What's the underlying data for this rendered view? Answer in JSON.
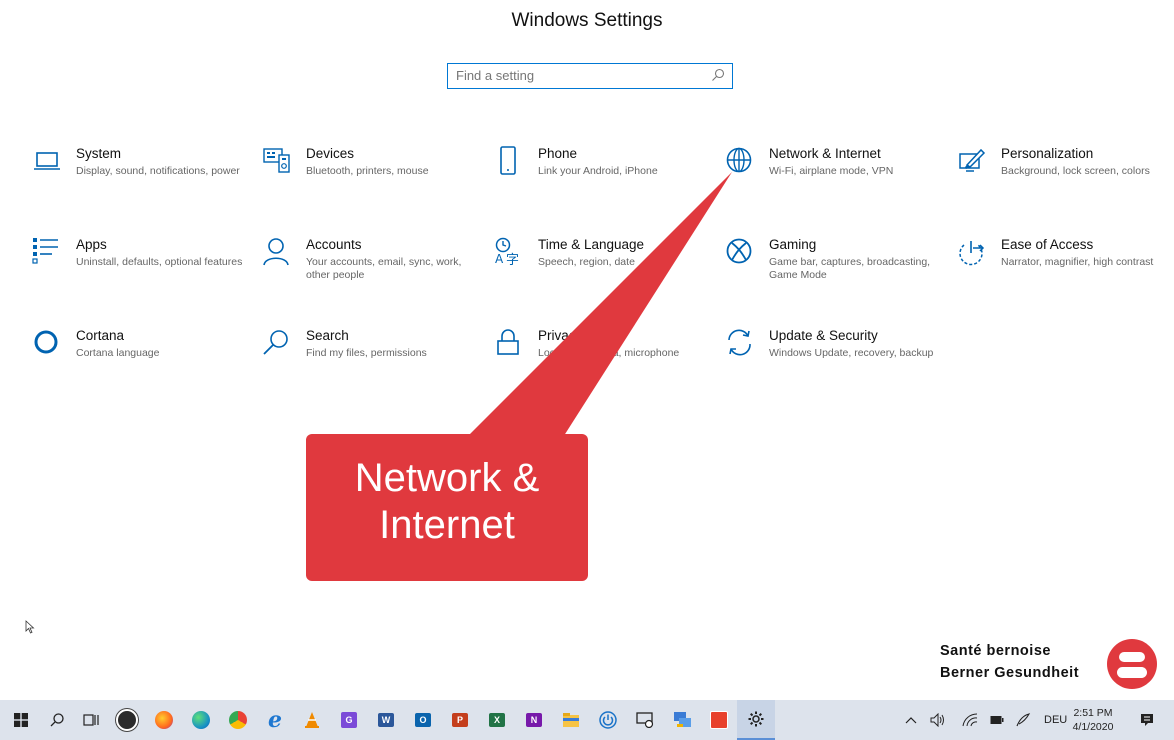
{
  "window": {
    "title": "Windows Settings"
  },
  "search": {
    "placeholder": "Find a setting"
  },
  "settings": [
    {
      "title": "System",
      "desc": "Display, sound, notifications, power",
      "icon": "laptop-icon"
    },
    {
      "title": "Devices",
      "desc": "Bluetooth, printers, mouse",
      "icon": "keyboard-icon"
    },
    {
      "title": "Phone",
      "desc": "Link your Android, iPhone",
      "icon": "phone-icon"
    },
    {
      "title": "Network & Internet",
      "desc": "Wi-Fi, airplane mode, VPN",
      "icon": "globe-icon"
    },
    {
      "title": "Personalization",
      "desc": "Background, lock screen, colors",
      "icon": "paint-icon"
    },
    {
      "title": "Apps",
      "desc": "Uninstall, defaults, optional features",
      "icon": "apps-list-icon"
    },
    {
      "title": "Accounts",
      "desc": "Your accounts, email, sync, work, other people",
      "icon": "person-icon"
    },
    {
      "title": "Time & Language",
      "desc": "Speech, region, date",
      "icon": "time-language-icon"
    },
    {
      "title": "Gaming",
      "desc": "Game bar, captures, broadcasting, Game Mode",
      "icon": "xbox-icon"
    },
    {
      "title": "Ease of Access",
      "desc": "Narrator, magnifier, high contrast",
      "icon": "ease-of-access-icon"
    },
    {
      "title": "Cortana",
      "desc": "Cortana language",
      "icon": "cortana-icon"
    },
    {
      "title": "Search",
      "desc": "Find my files, permissions",
      "icon": "search-icon"
    },
    {
      "title": "Privacy",
      "desc": "Location, camera, microphone",
      "icon": "lock-icon"
    },
    {
      "title": "Update & Security",
      "desc": "Windows Update, recovery, backup",
      "icon": "sync-icon"
    }
  ],
  "callout": {
    "line1": "Network &",
    "line2": "Internet",
    "color": "#e0393e"
  },
  "brand": {
    "line1": "Santé bernoise",
    "line2": "Berner Gesundheit",
    "color": "#e0393e"
  },
  "taskbar": {
    "apps": [
      "windows-start-icon",
      "search-icon",
      "task-view-icon",
      "cloud-app-icon",
      "firefox-icon",
      "edge-icon",
      "chrome-icon",
      "internet-explorer-icon",
      "vlc-icon",
      "greenshot-icon",
      "word-icon",
      "outlook-icon",
      "powerpoint-icon",
      "excel-icon",
      "onenote-icon",
      "file-explorer-icon",
      "power-app-icon",
      "remote-desktop-icon",
      "network-app-icon",
      "red-app-icon",
      "settings-gear-icon"
    ],
    "language": "DEU",
    "time": "2:51 PM",
    "date": "4/1/2020"
  },
  "accent": "#0078d4"
}
